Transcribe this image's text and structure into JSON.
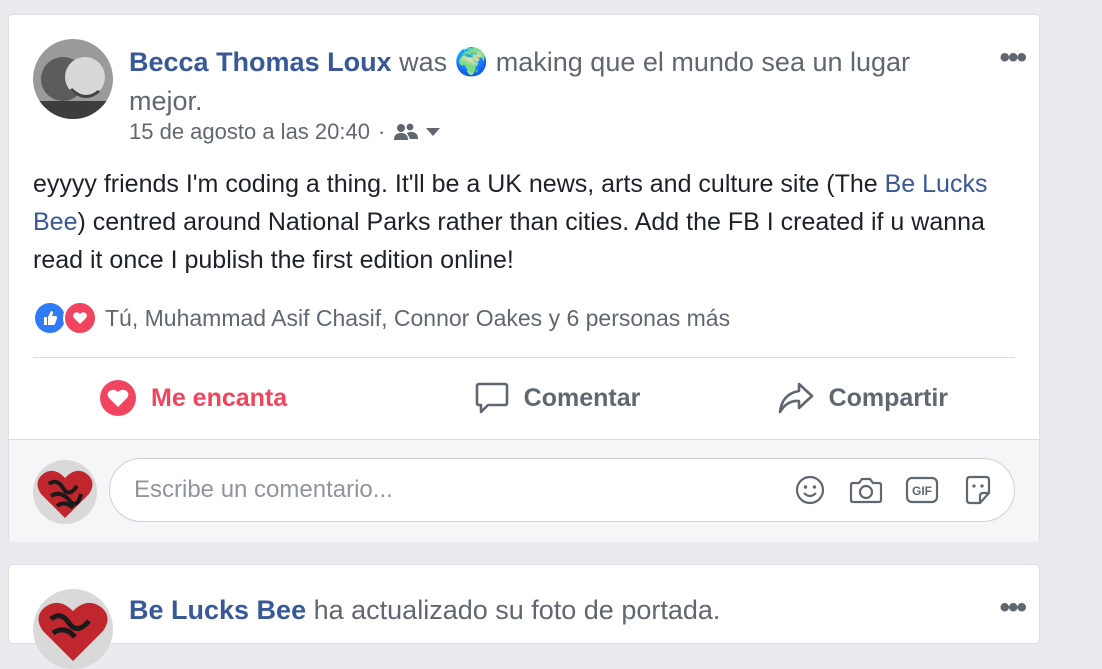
{
  "post": {
    "author": "Becca Thomas Loux",
    "was_text": "was",
    "activity_emoji": "🌍",
    "activity_text": "making que el mundo sea un lugar mejor.",
    "timestamp": "15 de agosto a las 20:40",
    "separator": "·",
    "body_before_link": "eyyyy friends I'm coding a thing. It'll be a UK news, arts and culture site (The ",
    "body_link": "Be Lucks Bee",
    "body_after_link": ") centred around National Parks rather than cities. Add the FB I created if u wanna read it once I publish the first edition online!",
    "reactions_text": "Tú, Muhammad Asif Chasif, Connor Oakes y 6 personas más",
    "more_dots": "•••"
  },
  "actions": {
    "love_label": "Me encanta",
    "comment_label": "Comentar",
    "share_label": "Compartir"
  },
  "comment": {
    "placeholder": "Escribe un comentario..."
  },
  "post2": {
    "author": "Be Lucks Bee",
    "activity_text": "ha actualizado su foto de portada.",
    "more_dots": "•••"
  },
  "colors": {
    "link": "#385898",
    "love": "#f0445f",
    "like": "#2f7cf6",
    "background": "#e9ebee"
  }
}
